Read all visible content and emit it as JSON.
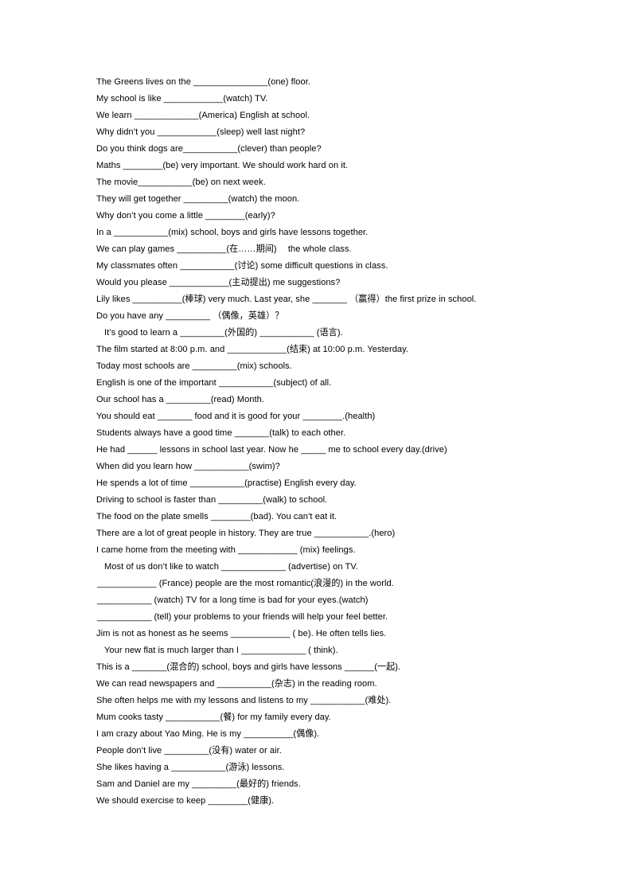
{
  "document": {
    "type": "worksheet",
    "page_background": "#ffffff",
    "text_color": "#000000",
    "lines": [
      "The Greens lives on the _______________(one) floor.",
      "My school is like ____________(watch) TV.",
      "We learn _____________(America) English at school.",
      "Why didn’t you ____________(sleep) well last night?",
      "Do you think dogs are___________(clever) than people?",
      "Maths ________(be) very important. We should work hard on it.",
      "The movie___________(be) on next week.",
      "They will get together _________(watch) the moon.",
      "Why don’t you come a little ________(early)?",
      "In a ___________(mix) school, boys and girls have lessons together.",
      "We can play games __________(在……期间)　 the whole class.",
      "My classmates often ___________(讨论) some difficult questions in class.",
      "Would you please ____________(主动提出) me suggestions?",
      "Lily likes __________(棒球) very much. Last year, she _______ （赢得）the first prize in school.",
      "Do you have any _________ （偶像，英雄）？",
      "It’s good to learn a _________(外国的) ___________ (语言).",
      "The film started at 8:00 p.m. and ____________(结束) at 10:00 p.m. Yesterday.",
      "Today most schools are _________(mix) schools.",
      "English is one of the important ___________(subject) of all.",
      "Our school has a _________(read) Month.",
      "You should eat _______ food and it is good for your ________.(health)",
      "Students always have a good time _______(talk) to each other.",
      "He had ______ lessons in school last year. Now he _____ me to school every day.(drive)",
      "When did you learn how ___________(swim)?",
      "He spends a lot of time ___________(practise) English every day.",
      "Driving to school is faster than _________(walk) to school.",
      "The food on the plate smells ________(bad). You can’t eat it.",
      "There are a lot of great people in history. They are true ___________.(hero)",
      "I came home from the meeting with ____________ (mix) feelings.",
      "Most of us don’t like to watch _____________ (advertise) on TV.",
      "____________ (France) people are the most romantic(浪漫的) in the world.",
      "___________ (watch) TV for a long time is bad for your eyes.(watch)",
      "___________ (tell) your problems to your friends will help your feel better.",
      "Jim is not as honest as he seems ____________ ( be). He often tells lies.",
      "Your new flat is much larger than I _____________ ( think).",
      "This is a _______(混合的) school, boys and girls have lessons ______(一起).",
      "We can read newspapers and ___________(杂志) in the reading room.",
      "She often helps me with my lessons and listens to my ___________(难处).",
      "Mum cooks tasty ___________(餐) for my family every day.",
      "I am crazy about Yao Ming. He is my __________(偶像).",
      "People don’t live _________(没有) water or air.",
      "She likes having a ___________(游泳) lessons.",
      "Sam and Daniel are my _________(最好的) friends.",
      "We should exercise to keep ________(健康)."
    ],
    "indented_line_indexes": [
      15,
      29,
      34
    ],
    "blank_led_line_indexes": [
      30,
      31,
      32
    ]
  }
}
